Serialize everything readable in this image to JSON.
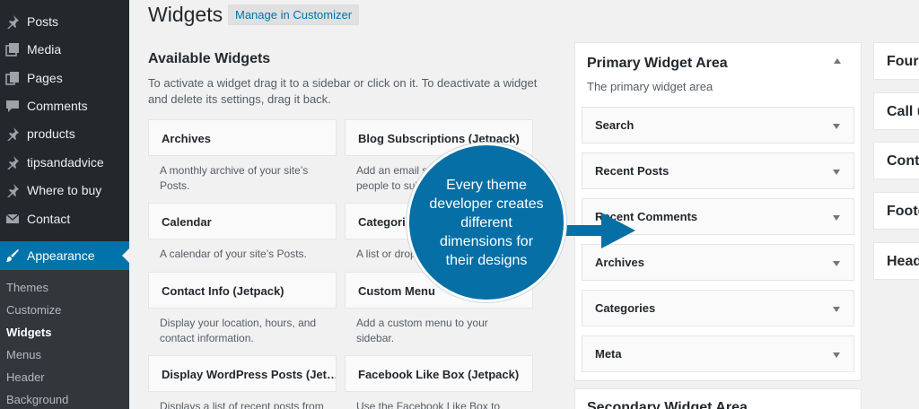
{
  "sidebar": {
    "items": [
      {
        "label": "Posts",
        "icon": "pushpin-icon"
      },
      {
        "label": "Media",
        "icon": "media-icon"
      },
      {
        "label": "Pages",
        "icon": "pages-icon"
      },
      {
        "label": "Comments",
        "icon": "comment-icon"
      },
      {
        "label": "products",
        "icon": "pushpin-icon"
      },
      {
        "label": "tipsandadvice",
        "icon": "pushpin-icon"
      },
      {
        "label": "Where to buy",
        "icon": "pushpin-icon"
      },
      {
        "label": "Contact",
        "icon": "mail-icon"
      },
      {
        "label": "Appearance",
        "icon": "paintbrush-icon"
      }
    ],
    "submenu": [
      "Themes",
      "Customize",
      "Widgets",
      "Menus",
      "Header",
      "Background"
    ],
    "colors": {
      "bg": "#23282d",
      "current": "#0073aa",
      "submenu_bg": "#32373c"
    }
  },
  "header": {
    "title": "Widgets",
    "customizer_button": "Manage in Customizer"
  },
  "available": {
    "title": "Available Widgets",
    "description": "To activate a widget drag it to a sidebar or click on it. To deactivate a widget and delete its settings, drag it back.",
    "widgets": [
      {
        "name": "Archives",
        "desc": "A monthly archive of your site’s\nPosts."
      },
      {
        "name": "Blog Subscriptions (Jetpack)",
        "desc": "Add an email si\npeople to sub"
      },
      {
        "name": "Calendar",
        "desc": "A calendar of your site’s Posts."
      },
      {
        "name": "Categories",
        "desc": "A list or drop"
      },
      {
        "name": "Contact Info (Jetpack)",
        "desc": "Display your location, hours, and\ncontact information."
      },
      {
        "name": "Custom Menu",
        "desc": "Add a custom menu to your\nsidebar."
      },
      {
        "name": "Display WordPress Posts (Jet…",
        "desc": "Displays a list of recent posts from"
      },
      {
        "name": "Facebook Like Box (Jetpack)",
        "desc": "Use the Facebook Like Box to"
      }
    ]
  },
  "primary_area": {
    "title": "Primary Widget Area",
    "description": "The primary widget area",
    "widgets": [
      "Search",
      "Recent Posts",
      "Recent Comments",
      "Archives",
      "Categories",
      "Meta"
    ]
  },
  "secondary_area": {
    "title": "Secondary Widget Area"
  },
  "right_panels": [
    "Four",
    "Call u",
    "Cont",
    "Foote",
    "Head"
  ],
  "callout": {
    "text": "Every theme developer creates different dimensions for their designs",
    "color": "#066fa6"
  }
}
